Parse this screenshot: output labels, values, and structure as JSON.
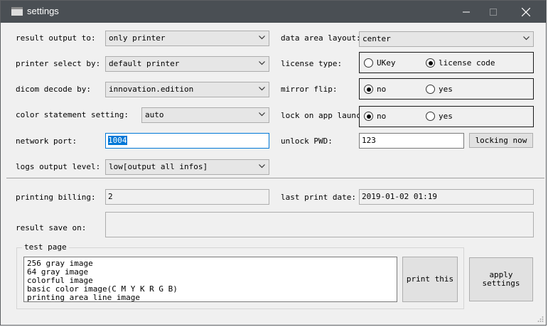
{
  "window": {
    "title": "settings"
  },
  "labels": {
    "result_output": "result output to:",
    "printer_select": "printer select by:",
    "dicom_decode": "dicom decode by:",
    "color_statement": "color statement setting:",
    "network_port": "network port:",
    "logs_output": "logs output level:",
    "data_area_layout": "data area layout:",
    "license_type": "license type:",
    "mirror_flip": "mirror flip:",
    "lock_on_app_launch": "lock on app launch",
    "unlock_pwd": "unlock PWD:",
    "printing_billing": "printing billing:",
    "last_print_date": "last print date:",
    "result_save_on": "result save on:",
    "test_page": "test page"
  },
  "values": {
    "result_output": "only printer",
    "printer_select": "default printer",
    "dicom_decode": "innovation.edition",
    "color_statement": "auto",
    "network_port": "1004",
    "logs_output": "low[output all infos]",
    "data_area_layout": "center",
    "unlock_pwd": "123",
    "printing_billing": "2",
    "last_print_date": "2019-01-02 01:19",
    "result_save_on": ""
  },
  "radios": {
    "license": {
      "options": [
        "UKey",
        "license code"
      ],
      "selected": "license code"
    },
    "mirror": {
      "options": [
        "no",
        "yes"
      ],
      "selected": "no"
    },
    "lock": {
      "options": [
        "no",
        "yes"
      ],
      "selected": "no"
    }
  },
  "buttons": {
    "locking_now": "locking now",
    "print_this": "print this",
    "apply_line1": "apply",
    "apply_line2": "settings"
  },
  "test_pages": [
    "256 gray image",
    "64 gray image",
    "colorful image",
    "basic color image(C M Y K R G B)",
    "printing area line image"
  ],
  "icons": {
    "window": "app-window-icon",
    "minimize": "minimize-icon",
    "maximize": "maximize-icon",
    "close": "close-icon",
    "dropdown": "chevron-down-icon",
    "resize": "resize-grip-icon"
  }
}
